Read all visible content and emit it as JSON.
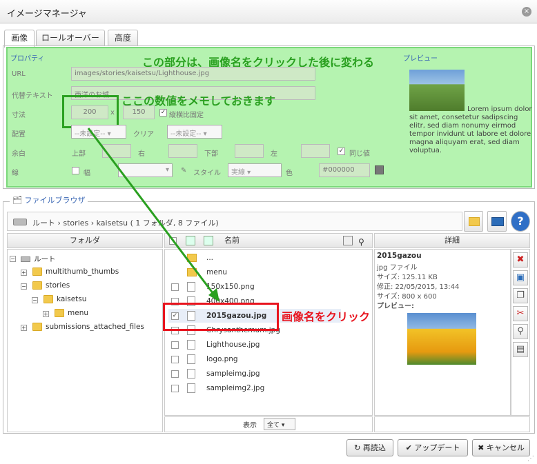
{
  "window": {
    "title": "イメージマネージャ",
    "close": "×"
  },
  "tabs": [
    {
      "label": "画像"
    },
    {
      "label": "ロールオーバー"
    },
    {
      "label": "高度"
    }
  ],
  "props": {
    "legend": "プロパティ",
    "url_label": "URL",
    "url_value": "images/stories/kaisetsu/Lighthouse.jpg",
    "alt_label": "代替テキスト",
    "alt_value": "西洋のお城",
    "size_label": "寸法",
    "width": "200",
    "x": "x",
    "height": "150",
    "ratio_label": "縦横比固定",
    "align_label": "配置",
    "align_value": "--未設定--",
    "clear_label": "クリア",
    "clear_value": "--未設定--",
    "margin_label": "余白",
    "top": "上部",
    "right": "右",
    "bottom": "下部",
    "left": "左",
    "same": "同じ値",
    "border_label": "線",
    "border_width": "幅",
    "style_label": "スタイル",
    "style_value": "実線",
    "color_label": "色",
    "color_value": "#000000"
  },
  "preview": {
    "legend": "プレビュー",
    "text": "Lorem ipsum dolor sit amet, consetetur sadipscing elitr, sed diam nonumy eirmod tempor invidunt ut labore et dolore magna aliquyam erat, sed diam voluptua."
  },
  "annotations": {
    "top": "この部分は、画像名をクリックした後に変わる",
    "memo": "ここの数値をメモしておきます",
    "click": "画像名をクリック"
  },
  "browser": {
    "legend": "ファイルブラウザ",
    "path": "ルート › stories › kaisetsu  ( 1 フォルダ, 8 ファイル)",
    "folder_header": "フォルダ",
    "name_header": "名前",
    "detail_header": "詳細",
    "display_label": "表示",
    "display_value": "全て"
  },
  "tree": [
    {
      "label": "ルート"
    },
    {
      "label": "multithumb_thumbs"
    },
    {
      "label": "stories"
    },
    {
      "label": "kaisetsu"
    },
    {
      "label": "menu"
    },
    {
      "label": "submissions_attached_files"
    }
  ],
  "files": [
    {
      "name": "..."
    },
    {
      "name": "menu"
    },
    {
      "name": "150x150.png"
    },
    {
      "name": "400x400.png"
    },
    {
      "name": "2015gazou.jpg"
    },
    {
      "name": "Chrysanthemum.jpg"
    },
    {
      "name": "Lighthouse.jpg"
    },
    {
      "name": "logo.png"
    },
    {
      "name": "sampleimg.jpg"
    },
    {
      "name": "sampleimg2.jpg"
    }
  ],
  "detail": {
    "name": "2015gazou",
    "type": "jpg ファイル",
    "size": "サイズ: 125.11 KB",
    "modified": "修正: 22/05/2015, 13:44",
    "dims": "サイズ: 800 x 600",
    "preview": "プレビュー:"
  },
  "buttons": {
    "reload": "再読込",
    "update": "アップデート",
    "cancel": "キャンセル"
  }
}
